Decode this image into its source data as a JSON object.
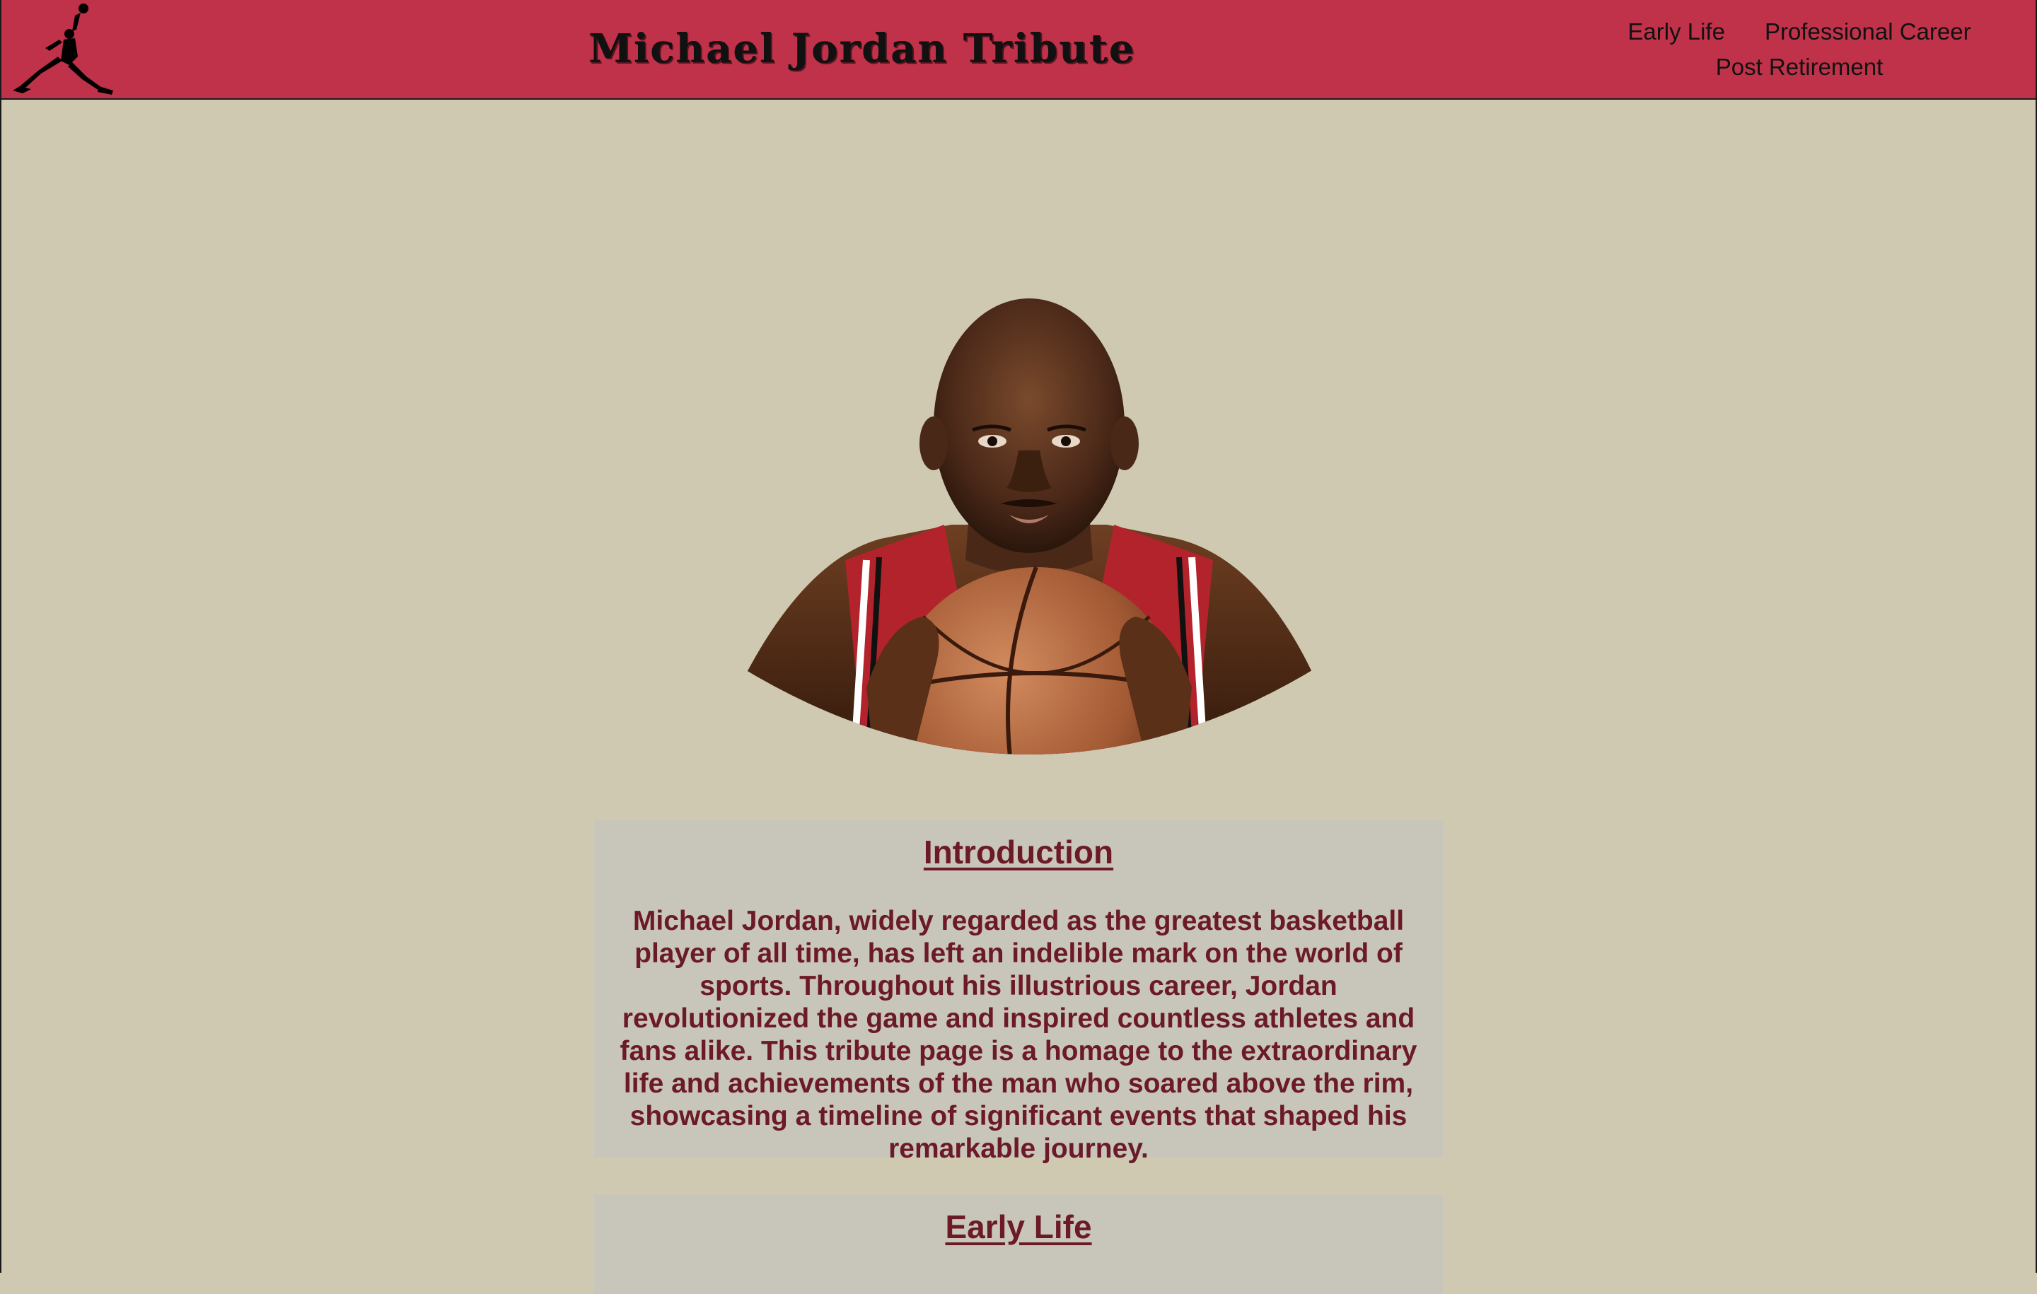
{
  "header": {
    "title": "Michael Jordan Tribute",
    "bg_color": "#c0324a",
    "logo_icon": "jumpman-logo-icon"
  },
  "nav": {
    "items": [
      {
        "label": "Early Life"
      },
      {
        "label": "Professional Career"
      },
      {
        "label": "Post Retirement"
      }
    ]
  },
  "hero": {
    "image_desc": "jordan-portrait-image"
  },
  "sections": {
    "intro": {
      "heading": "Introduction",
      "body": "Michael Jordan, widely regarded as the greatest basketball player of all time, has left an indelible mark on the world of sports. Throughout his illustrious career, Jordan revolutionized the game and inspired countless athletes and fans alike. This tribute page is a homage to the extraordinary life and achievements of the man who soared above the rim, showcasing a timeline of significant events that shaped his remarkable journey."
    },
    "early": {
      "heading": "Early Life"
    }
  },
  "colors": {
    "page_bg": "#cfc9b2",
    "section_bg": "#c8c6bb",
    "text_accent": "#6b1a26"
  }
}
